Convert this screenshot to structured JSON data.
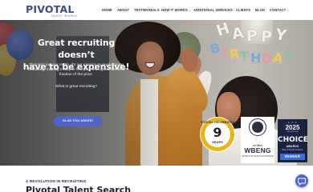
{
  "header": {
    "logo": {
      "wordmark": "PIVOTAL",
      "tagline": "TALENT SEARCH"
    },
    "nav": [
      {
        "label": "HOME",
        "caret": false
      },
      {
        "label": "ABOUT",
        "caret": false
      },
      {
        "label": "TESTIMONIALS",
        "caret": false
      },
      {
        "label": "HOW IT WORKS",
        "caret": true
      },
      {
        "label": "ADDITIONAL SERVICES",
        "caret": true
      },
      {
        "label": "CLIENTS",
        "caret": false
      },
      {
        "label": "BLOG",
        "caret": false
      },
      {
        "label": "CONTACT",
        "caret": true
      }
    ]
  },
  "hero": {
    "title_line1": "Great recruiting doesn’t",
    "title_line2": "have to be expensive!",
    "subtitle": "That isn’t just our motto, it’s our mission to revolutionize recruiting, making it easy to find your next great hire at a fraction of the price.",
    "question": "What is great recruiting?",
    "cta_label": "GLAD YOU ASKED!",
    "banner_letters": {
      "top": [
        "H",
        "A",
        "P",
        "P",
        "Y"
      ],
      "bottom": [
        "B",
        "I",
        "R",
        "T",
        "H",
        "D",
        "A",
        "Y"
      ]
    }
  },
  "badges": {
    "pivotal": {
      "top": "PIVOTAL CELEBRATES",
      "number": "9",
      "bottom": "YEARS"
    },
    "wbenc": {
      "certified": "certified",
      "name": "WBENG",
      "small": "WOMEN'S BUSINESS ENTERPRISE"
    },
    "choice": {
      "stars": "★ ★ ★",
      "year": "2025",
      "sub": "THE OFFICIAL",
      "word": "CHOICE",
      "awards": "AWARDS",
      "best_of": "Best of Woods & Choice",
      "winner": "WINNER"
    }
  },
  "section": {
    "eyebrow": "A REVOLUTION IN RECRUITING",
    "title": "Pivotal Talent Search"
  },
  "colors": {
    "brand_navy": "#3d4a8c",
    "accent_blue": "#4f65c9",
    "badge_gold": "#e9b418",
    "choice_navy": "#1b2242"
  },
  "icons": {
    "chat": "chat-bubble-icon"
  }
}
